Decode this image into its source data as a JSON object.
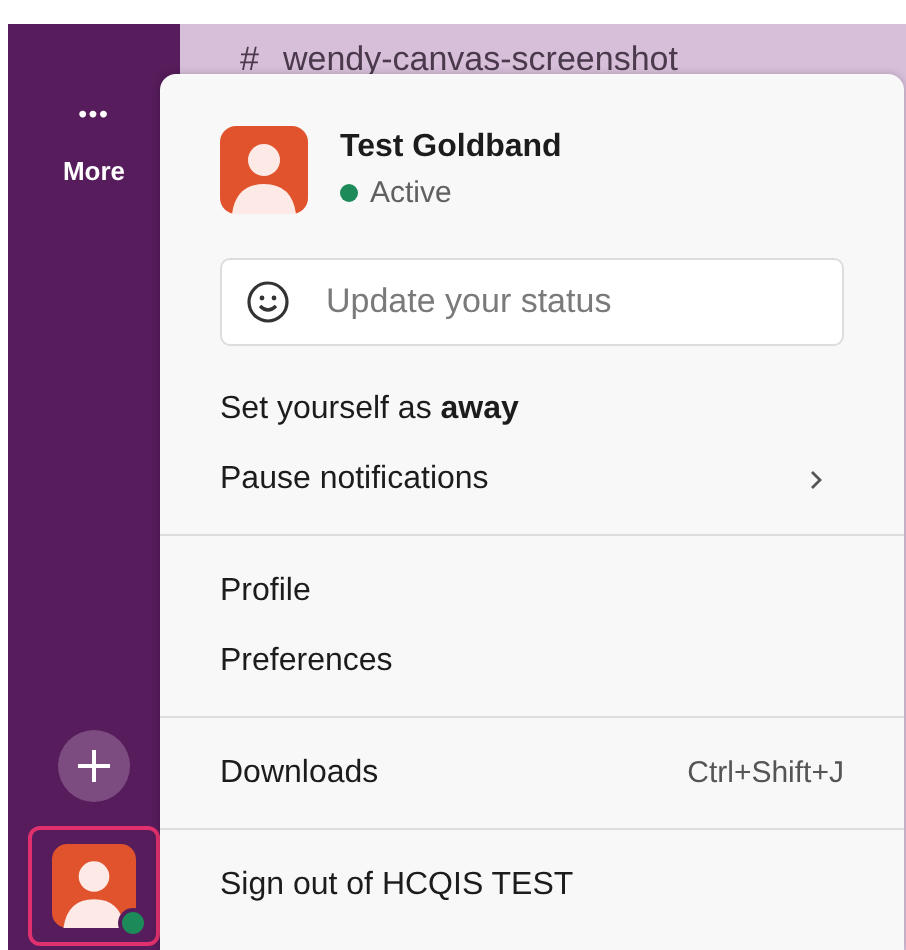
{
  "sidebar": {
    "items": [
      {
        "kind": "more",
        "icon_text": "•••",
        "label": "More"
      },
      {
        "kind": "add"
      }
    ],
    "user": {
      "selected": true,
      "online": true
    }
  },
  "channel": {
    "hash": "#",
    "name": "wendy-canvas-screenshot"
  },
  "menu": {
    "user": {
      "name": "Test Goldband",
      "status": "Active",
      "online": true
    },
    "status_field": {
      "placeholder": "Update your status"
    },
    "sections": [
      [
        {
          "label": "Set yourself as **away**"
        },
        {
          "label": "Pause notifications",
          "submenu": true
        }
      ],
      [
        {
          "label": "Profile"
        },
        {
          "label": "Preferences"
        }
      ],
      [
        {
          "label": "Downloads",
          "shortcut": "Ctrl+Shift+J"
        }
      ],
      [
        {
          "label": "Sign out of HCQIS TEST"
        }
      ]
    ]
  }
}
